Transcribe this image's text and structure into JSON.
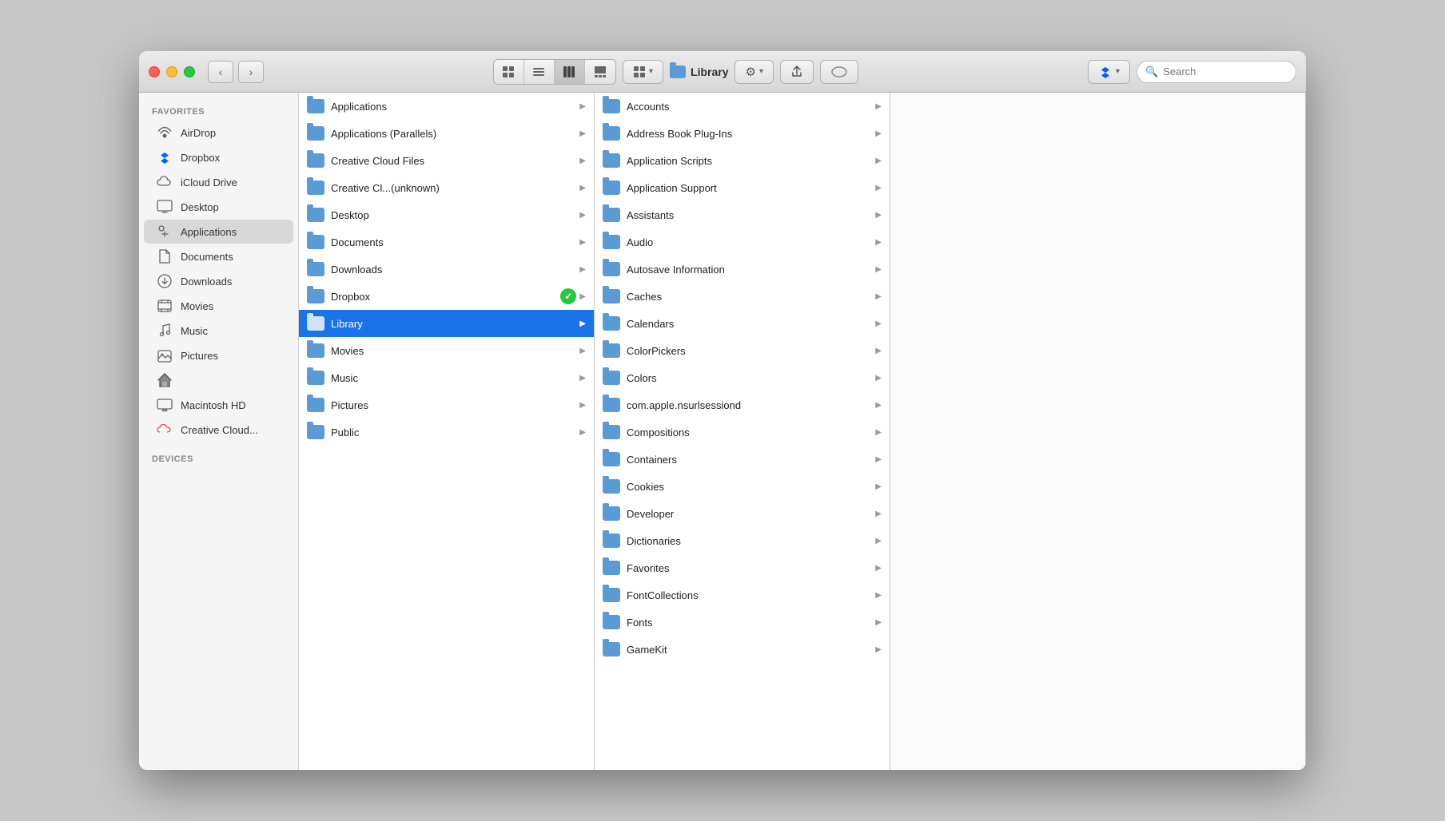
{
  "window": {
    "title": "Library",
    "traffic_lights": {
      "close": "close",
      "minimize": "minimize",
      "maximize": "maximize"
    },
    "toolbar": {
      "back_label": "‹",
      "forward_label": "›",
      "view_icons": [
        "⊞",
        "☰",
        "▦",
        "⊟"
      ],
      "active_view": 2,
      "arrange_label": "⊞",
      "action_label": "⚙",
      "share_label": "↑",
      "tag_label": "◯",
      "dropbox_label": "⬡",
      "search_placeholder": "Search"
    }
  },
  "sidebar": {
    "section_favorites": "Favorites",
    "section_devices": "Devices",
    "items": [
      {
        "id": "airdrop",
        "label": "AirDrop",
        "icon": "airdrop"
      },
      {
        "id": "dropbox",
        "label": "Dropbox",
        "icon": "dropbox"
      },
      {
        "id": "icloud",
        "label": "iCloud Drive",
        "icon": "icloud"
      },
      {
        "id": "desktop",
        "label": "Desktop",
        "icon": "desktop"
      },
      {
        "id": "applications",
        "label": "Applications",
        "icon": "applications",
        "active": true
      },
      {
        "id": "documents",
        "label": "Documents",
        "icon": "documents"
      },
      {
        "id": "downloads",
        "label": "Downloads",
        "icon": "downloads"
      },
      {
        "id": "movies",
        "label": "Movies",
        "icon": "movies"
      },
      {
        "id": "music",
        "label": "Music",
        "icon": "music"
      },
      {
        "id": "pictures",
        "label": "Pictures",
        "icon": "pictures"
      },
      {
        "id": "home",
        "label": "",
        "icon": "home"
      },
      {
        "id": "macintosh",
        "label": "Macintosh HD",
        "icon": "macintosh"
      },
      {
        "id": "creativecloud",
        "label": "Creative Cloud...",
        "icon": "creativecloud"
      }
    ]
  },
  "column1": {
    "items": [
      {
        "label": "Applications",
        "has_chevron": true
      },
      {
        "label": "Applications (Parallels)",
        "has_chevron": true
      },
      {
        "label": "Creative Cloud Files",
        "has_chevron": true
      },
      {
        "label": "Creative Cl...(unknown)",
        "has_chevron": true
      },
      {
        "label": "Desktop",
        "has_chevron": true
      },
      {
        "label": "Documents",
        "has_chevron": true
      },
      {
        "label": "Downloads",
        "has_chevron": true
      },
      {
        "label": "Dropbox",
        "has_chevron": true,
        "has_badge": true
      },
      {
        "label": "Library",
        "has_chevron": true,
        "selected": true
      },
      {
        "label": "Movies",
        "has_chevron": true
      },
      {
        "label": "Music",
        "has_chevron": true
      },
      {
        "label": "Pictures",
        "has_chevron": true
      },
      {
        "label": "Public",
        "has_chevron": true
      }
    ]
  },
  "column2": {
    "items": [
      {
        "label": "Accounts",
        "has_chevron": true
      },
      {
        "label": "Address Book Plug-Ins",
        "has_chevron": true
      },
      {
        "label": "Application Scripts",
        "has_chevron": true
      },
      {
        "label": "Application Support",
        "has_chevron": true
      },
      {
        "label": "Assistants",
        "has_chevron": true
      },
      {
        "label": "Audio",
        "has_chevron": true
      },
      {
        "label": "Autosave Information",
        "has_chevron": true
      },
      {
        "label": "Caches",
        "has_chevron": true
      },
      {
        "label": "Calendars",
        "has_chevron": true
      },
      {
        "label": "ColorPickers",
        "has_chevron": true
      },
      {
        "label": "Colors",
        "has_chevron": true
      },
      {
        "label": "com.apple.nsurlsessiond",
        "has_chevron": true
      },
      {
        "label": "Compositions",
        "has_chevron": true
      },
      {
        "label": "Containers",
        "has_chevron": true
      },
      {
        "label": "Cookies",
        "has_chevron": true
      },
      {
        "label": "Developer",
        "has_chevron": true
      },
      {
        "label": "Dictionaries",
        "has_chevron": true
      },
      {
        "label": "Favorites",
        "has_chevron": true
      },
      {
        "label": "FontCollections",
        "has_chevron": true
      },
      {
        "label": "Fonts",
        "has_chevron": true
      },
      {
        "label": "GameKit",
        "has_chevron": true
      }
    ]
  }
}
